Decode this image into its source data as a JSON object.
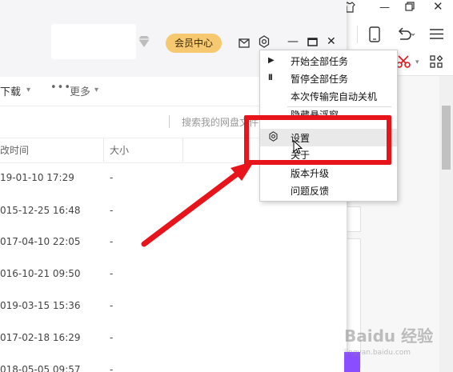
{
  "app": {
    "vip_label": "会员中心"
  },
  "toolbar": {
    "download_label": "下载",
    "more_label": "更多"
  },
  "search": {
    "placeholder": "搜索我的网盘文件"
  },
  "table": {
    "columns": [
      "改时间",
      "大小"
    ],
    "rows": [
      {
        "time": "19-01-10 17:29",
        "size": "-"
      },
      {
        "time": "015-12-25 16:48",
        "size": "-"
      },
      {
        "time": "017-04-10 22:05",
        "size": "-"
      },
      {
        "time": "016-10-21 09:50",
        "size": "-"
      },
      {
        "time": "019-03-15 15:36",
        "size": "-"
      },
      {
        "time": "017-02-18 16:29",
        "size": "-"
      },
      {
        "time": "018-05-05 09:57",
        "size": "-"
      }
    ]
  },
  "menu": {
    "items": [
      {
        "label": "开始全部任务",
        "icon": "play-icon"
      },
      {
        "label": "暂停全部任务",
        "icon": "pause-icon"
      },
      {
        "label": "本次传输完自动关机",
        "icon": ""
      },
      {
        "label": "隐藏悬浮窗",
        "icon": ""
      },
      {
        "label": "设置",
        "icon": "gear-icon"
      },
      {
        "label": "关于",
        "icon": ""
      },
      {
        "label": "版本升级",
        "icon": ""
      },
      {
        "label": "问题反馈",
        "icon": ""
      }
    ]
  },
  "watermark": {
    "text": "Baidu 经验",
    "sub": "jingyan.baidu.com"
  },
  "colors": {
    "highlight": "#e8141c",
    "vip": "#f6c870"
  }
}
